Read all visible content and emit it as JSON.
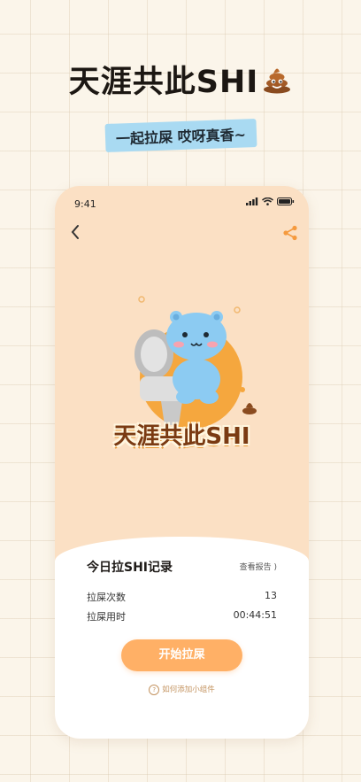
{
  "promo": {
    "headline": "天涯共此SHI",
    "tagline": "一起拉屎 哎呀真香~"
  },
  "status_bar": {
    "time": "9:41"
  },
  "app": {
    "logo_text": "天涯共此SHI",
    "record_title": "今日拉SHI记录",
    "report_link": "查看报告 )",
    "stats": [
      {
        "label": "拉屎次数",
        "value": "13"
      },
      {
        "label": "拉屎用时",
        "value": "00:44:51"
      }
    ],
    "start_button": "开始拉屎",
    "help_text": "如何添加小组件"
  },
  "colors": {
    "accent_orange": "#ffb066",
    "hero_background": "#fbe0c4",
    "tag_blue": "#a9daf2",
    "mascot_blue": "#8ccbf2"
  },
  "icons": [
    "poop-icon",
    "back-chevron-icon",
    "share-icon",
    "signal-icon",
    "wifi-icon",
    "battery-icon",
    "question-circle-icon"
  ]
}
